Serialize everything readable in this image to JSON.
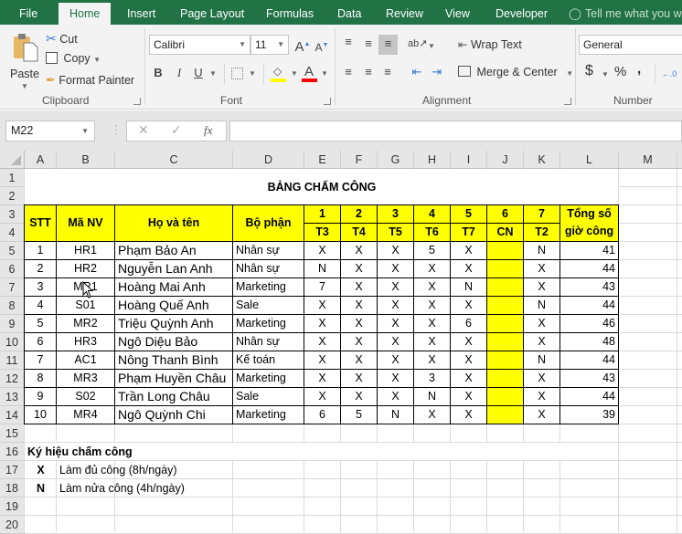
{
  "ribbon": {
    "tabs": [
      {
        "label": "File",
        "active": false
      },
      {
        "label": "Home",
        "active": true
      },
      {
        "label": "Insert",
        "active": false
      },
      {
        "label": "Page Layout",
        "active": false
      },
      {
        "label": "Formulas",
        "active": false
      },
      {
        "label": "Data",
        "active": false
      },
      {
        "label": "Review",
        "active": false
      },
      {
        "label": "View",
        "active": false
      },
      {
        "label": "Developer",
        "active": false
      }
    ],
    "tell_me": "Tell me what you wa",
    "clipboard": {
      "paste": "Paste",
      "cut": "Cut",
      "copy": "Copy",
      "format_painter": "Format Painter",
      "label": "Clipboard"
    },
    "font": {
      "name": "Calibri",
      "size": "11",
      "bold": "B",
      "italic": "I",
      "underline": "U",
      "font_color_letter": "A",
      "grow": "A",
      "shrink": "A",
      "label": "Font",
      "fill_color": "#ffff00",
      "text_color": "#ff0000"
    },
    "alignment": {
      "wrap_text": "Wrap Text",
      "merge_center": "Merge & Center",
      "label": "Alignment"
    },
    "number": {
      "format": "General",
      "currency": "$",
      "percent": "%",
      "comma": ",",
      "label": "Number"
    }
  },
  "formula_bar": {
    "name_box": "M22",
    "fx": "fx",
    "value": ""
  },
  "sheet": {
    "columns": [
      "A",
      "B",
      "C",
      "D",
      "E",
      "F",
      "G",
      "H",
      "I",
      "J",
      "K",
      "L",
      "M"
    ],
    "rows": [
      "1",
      "2",
      "3",
      "4",
      "5",
      "6",
      "7",
      "8",
      "9",
      "10",
      "11",
      "12",
      "13",
      "14",
      "15",
      "16",
      "17",
      "18",
      "19",
      "20"
    ],
    "title": "BẢNG CHẤM CÔNG",
    "headers": {
      "stt": "STT",
      "ma_nv": "Mã NV",
      "ho_ten": "Họ và tên",
      "bo_phan": "Bộ phận",
      "days": [
        "1",
        "2",
        "3",
        "4",
        "5",
        "6",
        "7"
      ],
      "weekdays": [
        "T3",
        "T4",
        "T5",
        "T6",
        "T7",
        "CN",
        "T2"
      ],
      "tong_line1": "Tổng số",
      "tong_line2": "giờ công"
    },
    "records": [
      {
        "stt": "1",
        "ma": "HR1",
        "ten": "Phạm Bảo An",
        "bp": "Nhân sự",
        "d": [
          "X",
          "X",
          "X",
          "5",
          "X",
          "",
          "N"
        ],
        "tong": "41"
      },
      {
        "stt": "2",
        "ma": "HR2",
        "ten": "Nguyễn Lan Anh",
        "bp": "Nhân sự",
        "d": [
          "N",
          "X",
          "X",
          "X",
          "X",
          "",
          "X"
        ],
        "tong": "44"
      },
      {
        "stt": "3",
        "ma": "MR1",
        "ten": "Hoàng Mai Anh",
        "bp": "Marketing",
        "d": [
          "7",
          "X",
          "X",
          "X",
          "N",
          "",
          "X"
        ],
        "tong": "43"
      },
      {
        "stt": "4",
        "ma": "S01",
        "ten": "Hoàng Quế Anh",
        "bp": "Sale",
        "d": [
          "X",
          "X",
          "X",
          "X",
          "X",
          "",
          "N"
        ],
        "tong": "44"
      },
      {
        "stt": "5",
        "ma": "MR2",
        "ten": "Triệu Quỳnh Anh",
        "bp": "Marketing",
        "d": [
          "X",
          "X",
          "X",
          "X",
          "6",
          "",
          "X"
        ],
        "tong": "46"
      },
      {
        "stt": "6",
        "ma": "HR3",
        "ten": "Ngô Diệu Bảo",
        "bp": "Nhân sự",
        "d": [
          "X",
          "X",
          "X",
          "X",
          "X",
          "",
          "X"
        ],
        "tong": "48"
      },
      {
        "stt": "7",
        "ma": "AC1",
        "ten": "Nông Thanh Bình",
        "bp": "Kế toán",
        "d": [
          "X",
          "X",
          "X",
          "X",
          "X",
          "",
          "N"
        ],
        "tong": "44"
      },
      {
        "stt": "8",
        "ma": "MR3",
        "ten": "Phạm Huyền Châu",
        "bp": "Marketing",
        "d": [
          "X",
          "X",
          "X",
          "3",
          "X",
          "",
          "X"
        ],
        "tong": "43"
      },
      {
        "stt": "9",
        "ma": "S02",
        "ten": "Trần Long Châu",
        "bp": "Sale",
        "d": [
          "X",
          "X",
          "X",
          "N",
          "X",
          "",
          "X"
        ],
        "tong": "44"
      },
      {
        "stt": "10",
        "ma": "MR4",
        "ten": "Ngô Quỳnh Chi",
        "bp": "Marketing",
        "d": [
          "6",
          "5",
          "N",
          "X",
          "X",
          "",
          "X"
        ],
        "tong": "39"
      }
    ],
    "legend": {
      "title": "Ký hiệu chấm công",
      "items": [
        {
          "symbol": "X",
          "text": "Làm đủ công (8h/ngày)"
        },
        {
          "symbol": "N",
          "text": "Làm nửa công (4h/ngày)"
        }
      ]
    },
    "highlight_color": "#ffff00"
  }
}
